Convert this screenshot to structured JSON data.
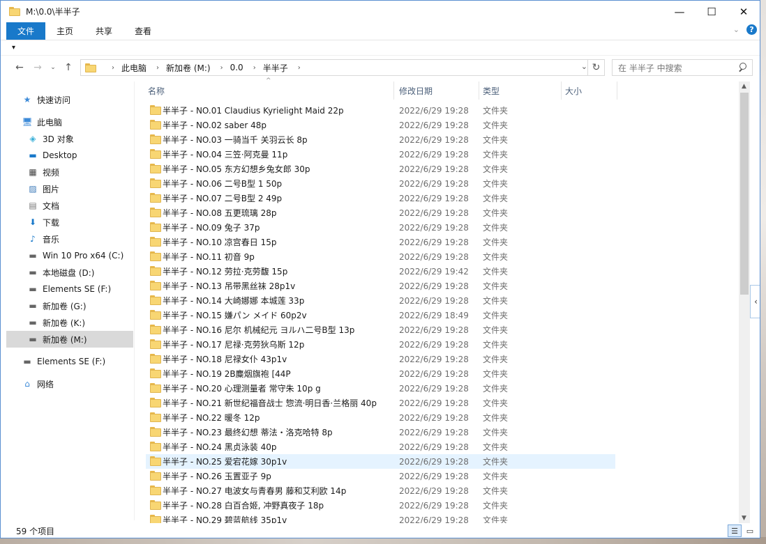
{
  "window": {
    "title": "M:\\0.0\\半半子",
    "controls": {
      "minimize": "—",
      "maximize": "☐",
      "close": "✕"
    }
  },
  "ribbon": {
    "tabs": [
      "文件",
      "主页",
      "共享",
      "查看"
    ],
    "help": "?"
  },
  "quick_access": {
    "customize": "▾"
  },
  "nav": {
    "back": "←",
    "forward": "→",
    "recent": "⌄",
    "up": "↑",
    "breadcrumb": [
      "此电脑",
      "新加卷 (M:)",
      "0.0",
      "半半子"
    ],
    "refresh": "↻",
    "search_placeholder": "在 半半子 中搜索"
  },
  "sidebar": {
    "items": [
      {
        "label": "快速访问",
        "icon": "star-icon"
      },
      {
        "label": "此电脑",
        "icon": "computer-icon"
      },
      {
        "label": "3D 对象",
        "icon": "cube-icon"
      },
      {
        "label": "Desktop",
        "icon": "desktop-icon"
      },
      {
        "label": "视频",
        "icon": "video-icon"
      },
      {
        "label": "图片",
        "icon": "pictures-icon"
      },
      {
        "label": "文档",
        "icon": "documents-icon"
      },
      {
        "label": "下载",
        "icon": "download-icon"
      },
      {
        "label": "音乐",
        "icon": "music-icon"
      },
      {
        "label": "Win 10 Pro x64 (C:)",
        "icon": "drive-icon"
      },
      {
        "label": "本地磁盘 (D:)",
        "icon": "drive-icon"
      },
      {
        "label": "Elements SE (F:)",
        "icon": "drive-icon"
      },
      {
        "label": "新加卷 (G:)",
        "icon": "drive-icon"
      },
      {
        "label": "新加卷 (K:)",
        "icon": "drive-icon"
      },
      {
        "label": "新加卷 (M:)",
        "icon": "drive-icon"
      },
      {
        "label": "Elements SE (F:)",
        "icon": "drive-icon"
      },
      {
        "label": "网络",
        "icon": "network-icon"
      }
    ]
  },
  "columns": {
    "name": "名称",
    "date": "修改日期",
    "type": "类型",
    "size": "大小",
    "sort_indicator": "^"
  },
  "files": [
    {
      "name": "半半子 - NO.01 Claudius Kyrielight Maid 22p",
      "date": "2022/6/29 19:28",
      "type": "文件夹"
    },
    {
      "name": "半半子 - NO.02 saber 48p",
      "date": "2022/6/29 19:28",
      "type": "文件夹"
    },
    {
      "name": "半半子 - NO.03 一骑当千 关羽云长 8p",
      "date": "2022/6/29 19:28",
      "type": "文件夹"
    },
    {
      "name": "半半子 - NO.04 三笠·阿克曼 11p",
      "date": "2022/6/29 19:28",
      "type": "文件夹"
    },
    {
      "name": "半半子 - NO.05 东方幻想乡兔女郎 30p",
      "date": "2022/6/29 19:28",
      "type": "文件夹"
    },
    {
      "name": "半半子 - NO.06 二号B型 1 50p",
      "date": "2022/6/29 19:28",
      "type": "文件夹"
    },
    {
      "name": "半半子 - NO.07 二号B型 2 49p",
      "date": "2022/6/29 19:28",
      "type": "文件夹"
    },
    {
      "name": "半半子 - NO.08 五更琉璃 28p",
      "date": "2022/6/29 19:28",
      "type": "文件夹"
    },
    {
      "name": "半半子 - NO.09 兔子 37p",
      "date": "2022/6/29 19:28",
      "type": "文件夹"
    },
    {
      "name": "半半子 - NO.10 凉宫春日 15p",
      "date": "2022/6/29 19:28",
      "type": "文件夹"
    },
    {
      "name": "半半子 - NO.11 初音 9p",
      "date": "2022/6/29 19:28",
      "type": "文件夹"
    },
    {
      "name": "半半子 - NO.12 劳拉·克劳馥 15p",
      "date": "2022/6/29 19:42",
      "type": "文件夹"
    },
    {
      "name": "半半子 - NO.13 吊带黑丝袜 28p1v",
      "date": "2022/6/29 19:28",
      "type": "文件夹"
    },
    {
      "name": "半半子 - NO.14 大崎娜娜 本城莲 33p",
      "date": "2022/6/29 19:28",
      "type": "文件夹"
    },
    {
      "name": "半半子 - NO.15 嫌パン メイド 60p2v",
      "date": "2022/6/29 18:49",
      "type": "文件夹"
    },
    {
      "name": "半半子 - NO.16 尼尔 机械纪元 ヨルハ二号B型 13p",
      "date": "2022/6/29 19:28",
      "type": "文件夹"
    },
    {
      "name": "半半子 - NO.17 尼禄·克劳狄乌斯 12p",
      "date": "2022/6/29 19:28",
      "type": "文件夹"
    },
    {
      "name": "半半子 - NO.18 尼禄女仆 43p1v",
      "date": "2022/6/29 19:28",
      "type": "文件夹"
    },
    {
      "name": "半半子 - NO.19 2B麋烟旗袍 [44P",
      "date": "2022/6/29 19:28",
      "type": "文件夹"
    },
    {
      "name": "半半子 - NO.20 心理测量者 常守朱 10p g",
      "date": "2022/6/29 19:28",
      "type": "文件夹"
    },
    {
      "name": "半半子 - NO.21 新世纪福音战士 惣流·明日香·兰格丽 40p",
      "date": "2022/6/29 19:28",
      "type": "文件夹"
    },
    {
      "name": "半半子 - NO.22 暖冬 12p",
      "date": "2022/6/29 19:28",
      "type": "文件夹"
    },
    {
      "name": "半半子 - NO.23 最终幻想 蒂法・洛克哈特 8p",
      "date": "2022/6/29 19:28",
      "type": "文件夹"
    },
    {
      "name": "半半子 - NO.24 黑贞泳装 40p",
      "date": "2022/6/29 19:28",
      "type": "文件夹"
    },
    {
      "name": "半半子 - NO.25 爱宕花嫁 30p1v",
      "date": "2022/6/29 19:28",
      "type": "文件夹"
    },
    {
      "name": "半半子 - NO.26 玉置亚子 9p",
      "date": "2022/6/29 19:28",
      "type": "文件夹"
    },
    {
      "name": "半半子 - NO.27 电波女与青春男 藤和艾利欧 14p",
      "date": "2022/6/29 19:28",
      "type": "文件夹"
    },
    {
      "name": "半半子 - NO.28 白百合姬, 冲野真夜子 18p",
      "date": "2022/6/29 19:28",
      "type": "文件夹"
    },
    {
      "name": "半半子 - NO.29 碧蓝航线 35p1v",
      "date": "2022/6/29 19:28",
      "type": "文件夹"
    }
  ],
  "status": {
    "count": "59 个项目"
  },
  "colors": {
    "accent": "#1979ca",
    "folder": "#f8d673",
    "hover": "#e5f3ff",
    "selected": "#d9d9d9"
  }
}
